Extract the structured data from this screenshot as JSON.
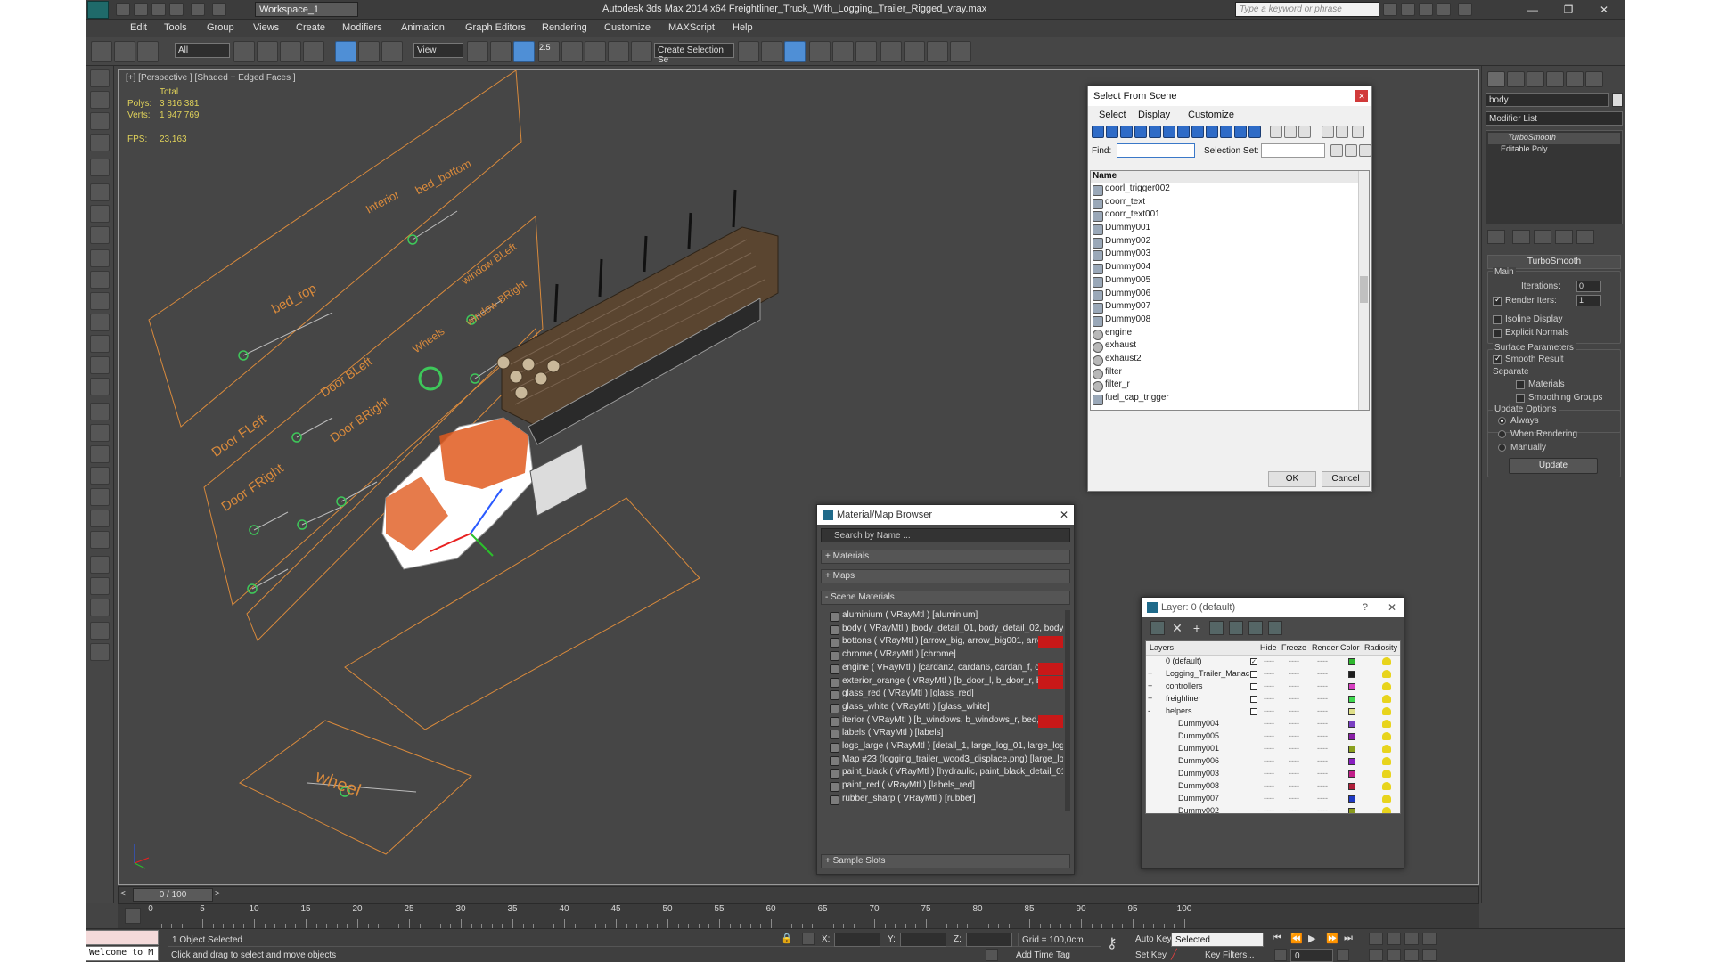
{
  "window": {
    "title": "Autodesk 3ds Max  2014 x64     Freightliner_Truck_With_Logging_Trailer_Rigged_vray.max",
    "workspace": "Workspace_1",
    "search_placeholder": "Type a keyword or phrase"
  },
  "menu": [
    "Edit",
    "Tools",
    "Group",
    "Views",
    "Create",
    "Modifiers",
    "Animation",
    "Graph Editors",
    "Rendering",
    "Customize",
    "MAXScript",
    "Help"
  ],
  "toolbar": {
    "filter": "All",
    "ref_coord": "View",
    "snap_value": "2.5",
    "selection_set": "Create Selection Se"
  },
  "viewport": {
    "label": "[+] [Perspective ] [Shaded + Edged Faces ]",
    "stats": {
      "total_label": "Total",
      "polys_label": "Polys:",
      "polys": "3 816 381",
      "verts_label": "Verts:",
      "verts": "1 947 769",
      "fps_label": "FPS:",
      "fps": "23,163"
    },
    "rig_labels": {
      "bed_top": "bed_top",
      "interior": "Interior",
      "bed_bottom": "bed_bottom",
      "window_bleft": "window BLeft",
      "window_bright": "window BRight",
      "wheels": "Wheels",
      "door_bleft": "Door BLeft",
      "door_bright": "Door BRight",
      "door_fleft": "Door FLeft",
      "door_fright": "Door FRight",
      "wheel": "wheel"
    }
  },
  "select_from_scene": {
    "title": "Select From Scene",
    "menu": [
      "Select",
      "Display",
      "Customize"
    ],
    "find_label": "Find:",
    "selection_set_label": "Selection Set:",
    "column": "Name",
    "items": [
      {
        "name": "doorl_trigger002",
        "shape": "box"
      },
      {
        "name": "doorr_text",
        "shape": "box"
      },
      {
        "name": "doorr_text001",
        "shape": "box"
      },
      {
        "name": "Dummy001",
        "shape": "box"
      },
      {
        "name": "Dummy002",
        "shape": "box"
      },
      {
        "name": "Dummy003",
        "shape": "box"
      },
      {
        "name": "Dummy004",
        "shape": "box"
      },
      {
        "name": "Dummy005",
        "shape": "box"
      },
      {
        "name": "Dummy006",
        "shape": "box"
      },
      {
        "name": "Dummy007",
        "shape": "box"
      },
      {
        "name": "Dummy008",
        "shape": "box"
      },
      {
        "name": "engine",
        "shape": "circle"
      },
      {
        "name": "exhaust",
        "shape": "circle"
      },
      {
        "name": "exhaust2",
        "shape": "circle"
      },
      {
        "name": "filter",
        "shape": "circle"
      },
      {
        "name": "filter_r",
        "shape": "circle"
      },
      {
        "name": "fuel_cap_trigger",
        "shape": "box"
      }
    ],
    "ok": "OK",
    "cancel": "Cancel"
  },
  "material_browser": {
    "title": "Material/Map Browser",
    "search_placeholder": "Search by Name ...",
    "groups": {
      "materials": "+ Materials",
      "maps": "+ Maps",
      "scene": "- Scene Materials",
      "sample": "+ Sample Slots"
    },
    "scene_materials": [
      {
        "text": "aluminium  ( VRayMtl ) [aluminium]",
        "red": false
      },
      {
        "text": "body ( VRayMtl ) [body_detail_01, body_detail_02, body_detail...",
        "red": false
      },
      {
        "text": "bottons ( VRayMtl ) [arrow_big, arrow_big001, arrow_little, arr...",
        "red": true
      },
      {
        "text": "chrome ( VRayMtl ) [chrome]",
        "red": false
      },
      {
        "text": "engine ( VRayMtl ) [cardan2, cardan6, cardan_f, detail, differen...",
        "red": true
      },
      {
        "text": "exterior_orange ( VRayMtl ) [b_door_l, b_door_r, body, chrome...",
        "red": true
      },
      {
        "text": "glass_red ( VRayMtl ) [glass_red]",
        "red": false
      },
      {
        "text": "glass_white ( VRayMtl ) [glass_white]",
        "red": false
      },
      {
        "text": "iterior ( VRayMtl ) [b_windows, b_windows_r, bed, bed_top, d...",
        "red": true
      },
      {
        "text": "labels ( VRayMtl ) [labels]",
        "red": false
      },
      {
        "text": "logs_large ( VRayMtl ) [detail_1, large_log_01, large_log_02, la...",
        "red": false
      },
      {
        "text": "Map #23 (logging_trailer_wood3_displace.png) [large_log_01, l...",
        "red": false
      },
      {
        "text": "paint_black ( VRayMtl ) [hydraulic, paint_black_detail_01, paint...",
        "red": false
      },
      {
        "text": "paint_red ( VRayMtl ) [labels_red]",
        "red": false
      },
      {
        "text": "rubber_sharp ( VRayMtl ) [rubber]",
        "red": false
      }
    ]
  },
  "layer_dialog": {
    "title": "Layer: 0 (default)",
    "help": "?",
    "columns": [
      "Layers",
      "Hide",
      "Freeze",
      "Render",
      "Color",
      "Radiosity"
    ],
    "rows": [
      {
        "name": "0 (default)",
        "indent": 0,
        "exp": "",
        "check": true,
        "color": "#2fb82f"
      },
      {
        "name": "Logging_Trailer_Manac",
        "indent": 0,
        "exp": "+",
        "check": false,
        "color": "#1e1e1e"
      },
      {
        "name": "controllers",
        "indent": 0,
        "exp": "+",
        "check": false,
        "color": "#d83fc2"
      },
      {
        "name": "freighliner",
        "indent": 0,
        "exp": "+",
        "check": false,
        "color": "#3fd84f"
      },
      {
        "name": "helpers",
        "indent": 0,
        "exp": "-",
        "check": false,
        "color": "#e0e08a"
      },
      {
        "name": "Dummy004",
        "indent": 1,
        "exp": "",
        "check": false,
        "color": "#7a3fc2"
      },
      {
        "name": "Dummy005",
        "indent": 1,
        "exp": "",
        "check": false,
        "color": "#8a1fa8"
      },
      {
        "name": "Dummy001",
        "indent": 1,
        "exp": "",
        "check": false,
        "color": "#8aa01e"
      },
      {
        "name": "Dummy006",
        "indent": 1,
        "exp": "",
        "check": false,
        "color": "#8a1fc2"
      },
      {
        "name": "Dummy003",
        "indent": 1,
        "exp": "",
        "check": false,
        "color": "#c21f8a"
      },
      {
        "name": "Dummy008",
        "indent": 1,
        "exp": "",
        "check": false,
        "color": "#b01e3a"
      },
      {
        "name": "Dummy007",
        "indent": 1,
        "exp": "",
        "check": false,
        "color": "#1f3ac2"
      },
      {
        "name": "Dummy002",
        "indent": 1,
        "exp": "",
        "check": false,
        "color": "#8a9a1e"
      }
    ],
    "dash": "----"
  },
  "command_panel": {
    "object_name": "body",
    "modifier_list": "Modifier List",
    "stack": [
      "TurboSmooth",
      "Editable Poly"
    ],
    "rollout": "TurboSmooth",
    "main_label": "Main",
    "iterations_label": "Iterations:",
    "iterations": "0",
    "render_iters_label": "Render Iters:",
    "render_iters": "1",
    "isoline": "Isoline Display",
    "explicit": "Explicit Normals",
    "surface_params": "Surface Parameters",
    "smooth_result": "Smooth Result",
    "separate": "Separate",
    "materials": "Materials",
    "smoothing_groups": "Smoothing Groups",
    "update_options": "Update Options",
    "always": "Always",
    "when_rendering": "When Rendering",
    "manually": "Manually",
    "update": "Update"
  },
  "timeline": {
    "frame": "0 / 100",
    "ticks": [
      "0",
      "5",
      "10",
      "15",
      "20",
      "25",
      "30",
      "35",
      "40",
      "45",
      "50",
      "55",
      "60",
      "65",
      "70",
      "75",
      "80",
      "85",
      "90",
      "95",
      "100"
    ]
  },
  "status": {
    "maxscript": "Welcome to M",
    "selected": "1 Object Selected",
    "prompt": "Click and drag to select and move objects",
    "x_label": "X:",
    "y_label": "Y:",
    "z_label": "Z:",
    "grid": "Grid = 100,0cm",
    "add_time_tag": "Add Time Tag",
    "auto_key": "Auto Key",
    "set_key": "Set Key",
    "selected_dd": "Selected",
    "key_filters": "Key Filters...",
    "frame": "0"
  }
}
